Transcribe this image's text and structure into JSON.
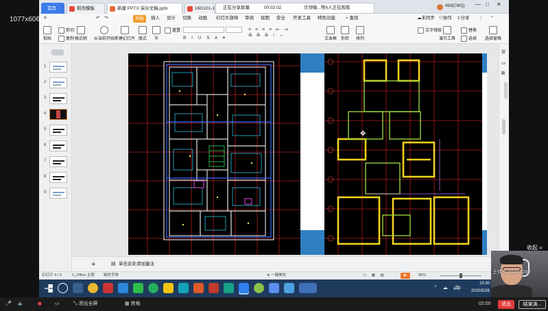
{
  "overlay": {
    "resolution": "1077x606(56%)"
  },
  "tabs": [
    {
      "label": "首页",
      "color": "#3d7bea"
    },
    {
      "label": "稻壳模板",
      "color": "#e8463a"
    },
    {
      "label": "新建 PPTX 演示文稿.pptx",
      "color": "#e8663a"
    },
    {
      "label": "16G101-1",
      "color": "#e8463a"
    }
  ],
  "share": {
    "status": "正在分享屏幕",
    "time": "00:02:02",
    "viewers": "许领微...等8人正在观看"
  },
  "account": {
    "user": "493(CWQ)",
    "sync": "未同步",
    "collab": "协作",
    "share": "分享"
  },
  "ribbon_tabs": [
    "开始",
    "插入",
    "设计",
    "切换",
    "动画",
    "幻灯片放映",
    "审阅",
    "视图",
    "安全",
    "开发工具",
    "特色功能"
  ],
  "ribbon_search": "查找",
  "toolbar": {
    "paste": "粘贴",
    "cut": "剪切",
    "copy": "复制",
    "format_painter": "格式刷",
    "from_current": "从当前开始",
    "new_slide": "新建幻灯片",
    "layout": "版式",
    "section": "节",
    "reset": "重置",
    "textbox": "文本框",
    "shape": "形状",
    "arrange": "排列",
    "text_tools": "文字排版",
    "replace": "替换",
    "select": "选择",
    "slide_show_tool": "演示工具",
    "select_pane": "选择窗格"
  },
  "slides": {
    "numbers": [
      "1",
      "2",
      "3",
      "4",
      "5",
      "6",
      "7",
      "8",
      "9"
    ],
    "selected": "4"
  },
  "notes": {
    "placeholder": "单击此处添加备注",
    "add_label": "+"
  },
  "status": {
    "slide_info": "幻灯片 4 / 9",
    "theme": "1_Office 主题",
    "ink_hint": "缺失字体",
    "beautify": "一键美化",
    "zoom": "85%"
  },
  "taskbar": {
    "time": "15:30",
    "date": "2020/5/26",
    "ime": "中"
  },
  "meeting": {
    "exit_fullscreen": "退出全屏",
    "gallery": "宫格",
    "timer": "02:00",
    "leave": "退出",
    "end": "结束演...",
    "collapse": "收起",
    "presenter": "王伟东 2110 0289"
  },
  "colors": {
    "accent": "#3d7bea",
    "ribbon_active": "#f29b2c",
    "slide_blue": "#2f7fc1",
    "leave_red": "#e03a3a",
    "taskbar": "#1e3b5e"
  }
}
